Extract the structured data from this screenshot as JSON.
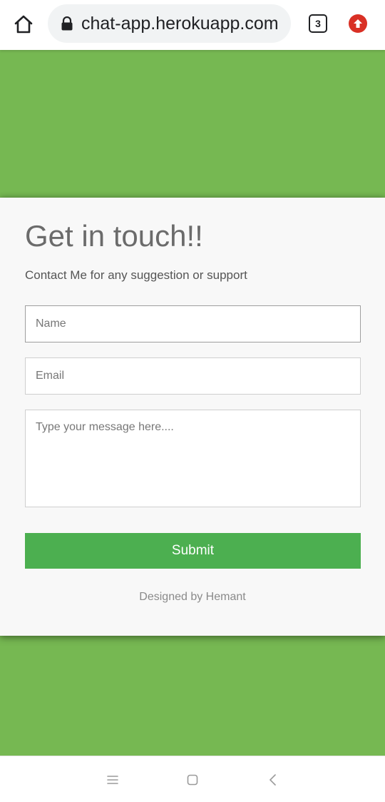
{
  "browser": {
    "url": "chat-app.herokuapp.com",
    "tab_count": "3",
    "icons": {
      "home": "home-icon",
      "lock": "lock-icon",
      "update": "update-arrow-icon"
    }
  },
  "colors": {
    "page_bg": "#76b852",
    "card_bg": "#f8f8f8",
    "submit_bg": "#4caf50",
    "update_badge": "#d93025"
  },
  "contact_form": {
    "title": "Get in touch!!",
    "subtitle": "Contact Me for any suggestion or support",
    "name_placeholder": "Name",
    "email_placeholder": "Email",
    "message_placeholder": "Type your message here....",
    "submit_label": "Submit",
    "footer": "Designed by Hemant"
  },
  "nav_bar": {
    "icons": [
      "menu-icon",
      "home-square-icon",
      "back-chevron-icon"
    ]
  }
}
